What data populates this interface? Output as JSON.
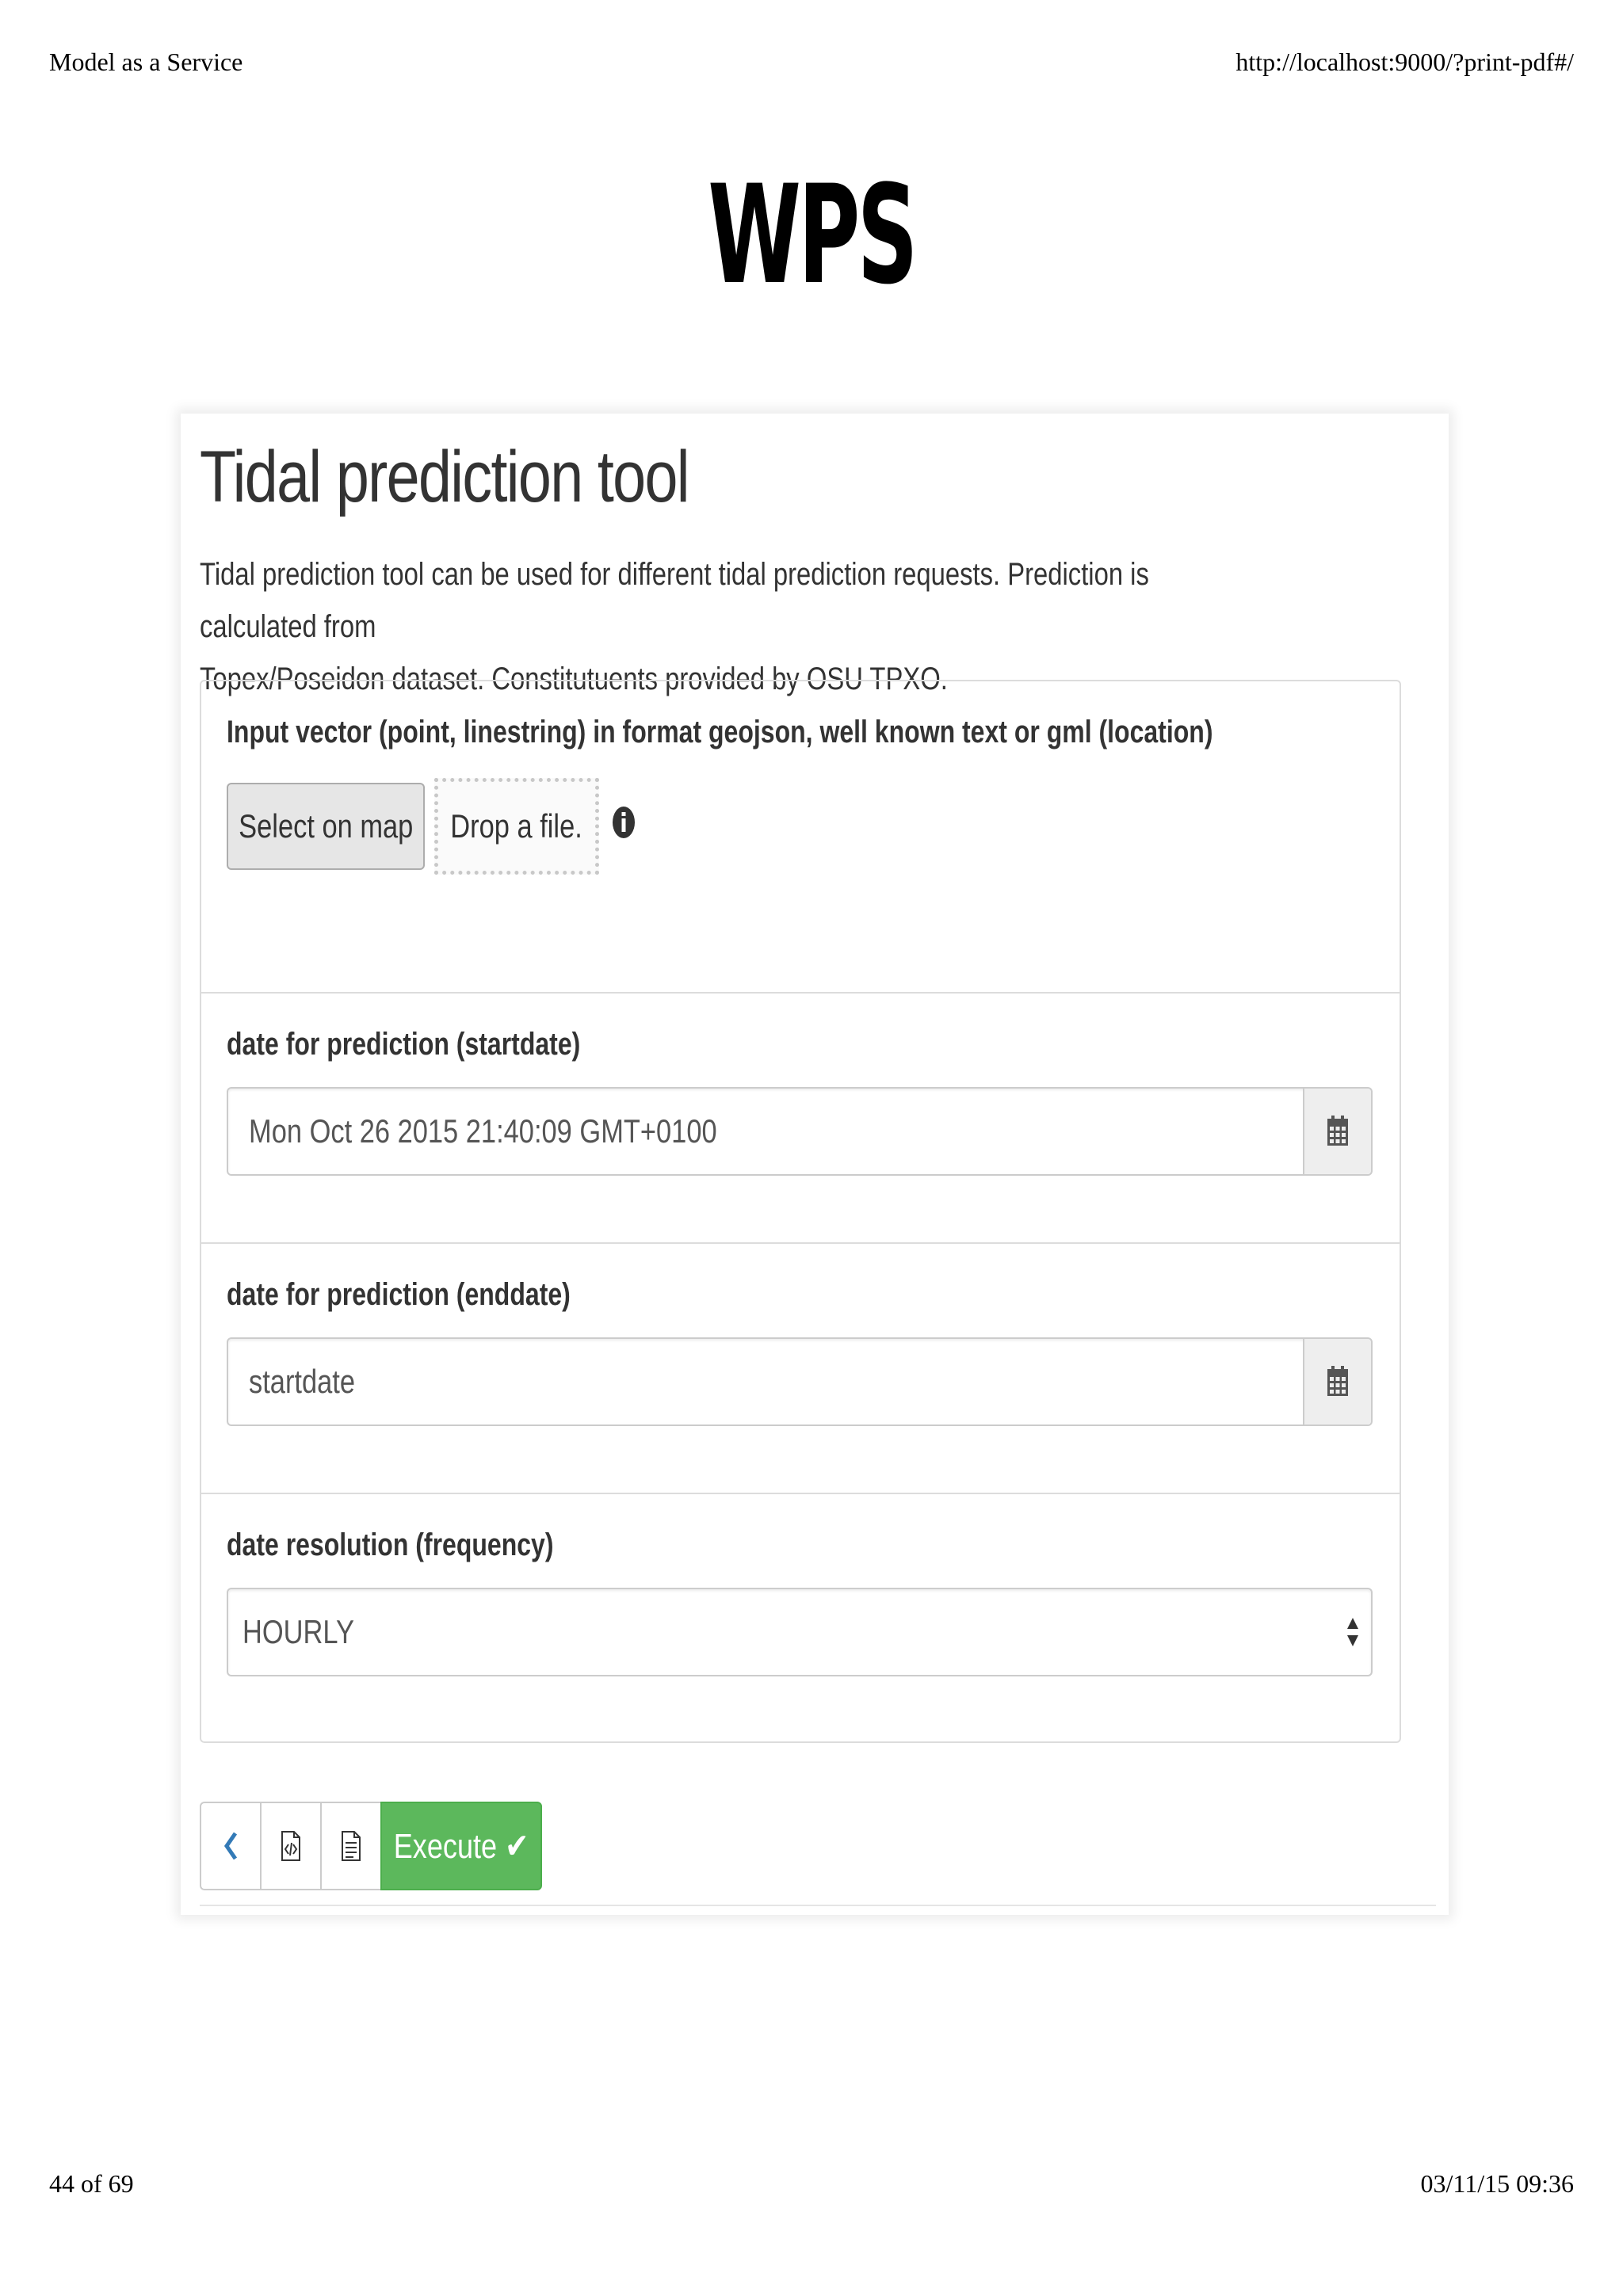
{
  "print_header": {
    "title": "Model as a Service",
    "url": "http://localhost:9000/?print-pdf#/"
  },
  "print_footer": {
    "page": "44 of 69",
    "datetime": "03/11/15 09:36"
  },
  "slide": {
    "title": "WPS"
  },
  "tool": {
    "title": "Tidal prediction tool",
    "description": "Tidal prediction tool can be used for different tidal prediction requests. Prediction is calculated from\nTopex/Poseidon dataset. Constitutuents provided by OSU TPXO."
  },
  "form": {
    "location": {
      "label": "Input vector (point, linestring) in format geojson, well known text or gml (location)",
      "select_on_map": "Select on map",
      "drop_file": "Drop a file.",
      "info_icon": "info-circle-icon"
    },
    "startdate": {
      "label": "date for prediction (startdate)",
      "value": "Mon Oct 26 2015 21:40:09 GMT+0100",
      "icon": "calendar-icon"
    },
    "enddate": {
      "label": "date for prediction (enddate)",
      "placeholder": "startdate",
      "icon": "calendar-icon"
    },
    "frequency": {
      "label": "date resolution (frequency)",
      "selected": "HOURLY"
    }
  },
  "actions": {
    "back_icon": "chevron-left-icon",
    "code_icon": "file-code-icon",
    "text_icon": "file-text-icon",
    "execute": "Execute ✔"
  },
  "colors": {
    "execute_green": "#5cb85c",
    "back_blue": "#337ab7"
  }
}
